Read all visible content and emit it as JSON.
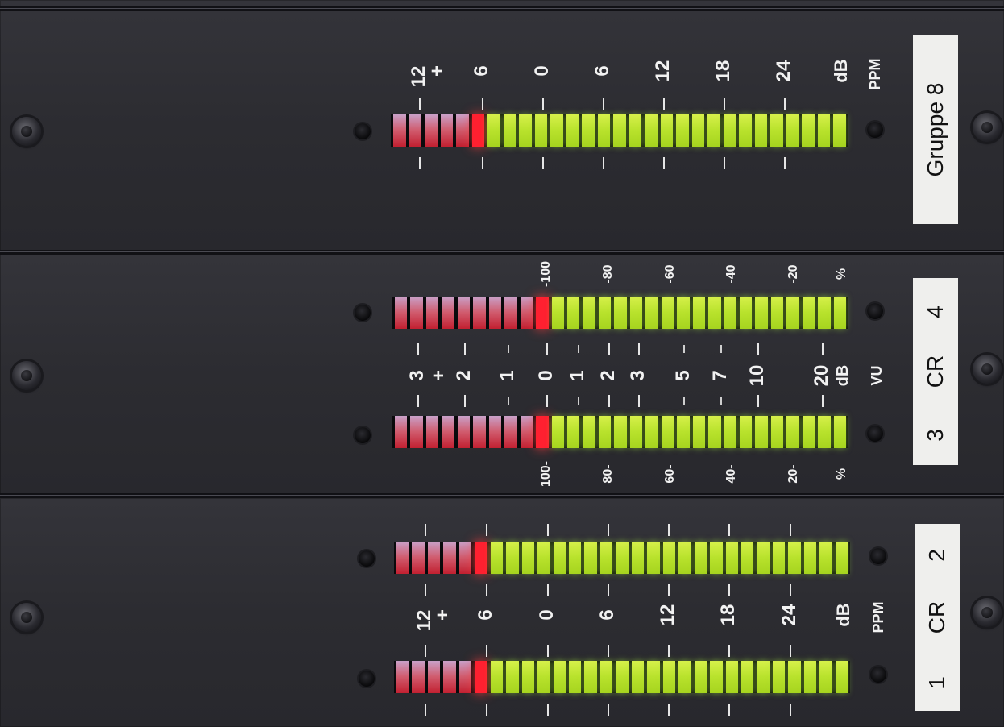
{
  "panels": {
    "top": {
      "plate": "Gruppe 8",
      "type_label": "PPM",
      "unit": "dB",
      "scale": [
        "12",
        "+",
        "6",
        "0",
        "6",
        "12",
        "18",
        "24",
        "dB"
      ]
    },
    "middle": {
      "plate_left": "3",
      "plate_mid": "CR",
      "plate_right": "4",
      "type_label": "VU",
      "vu_scale": [
        "3",
        "+",
        "2",
        "1",
        "0",
        "1",
        "2",
        "3",
        "5",
        "7",
        "10",
        "20",
        "dB"
      ],
      "pct_top": [
        "-100",
        "-80",
        "-60",
        "-40",
        "-20",
        "%"
      ],
      "pct_bottom": [
        "100-",
        "80-",
        "60-",
        "40-",
        "20-",
        "%"
      ]
    },
    "bottom": {
      "plate_left": "1",
      "plate_mid": "CR",
      "plate_right": "2",
      "type_label": "PPM",
      "scale": [
        "12",
        "+",
        "6",
        "0",
        "6",
        "12",
        "18",
        "24",
        "dB"
      ]
    }
  },
  "colors": {
    "green_led": "#b8e22c",
    "red_led": "#ff1f2a",
    "panel": "#2e2e33",
    "plate": "#efefed"
  }
}
